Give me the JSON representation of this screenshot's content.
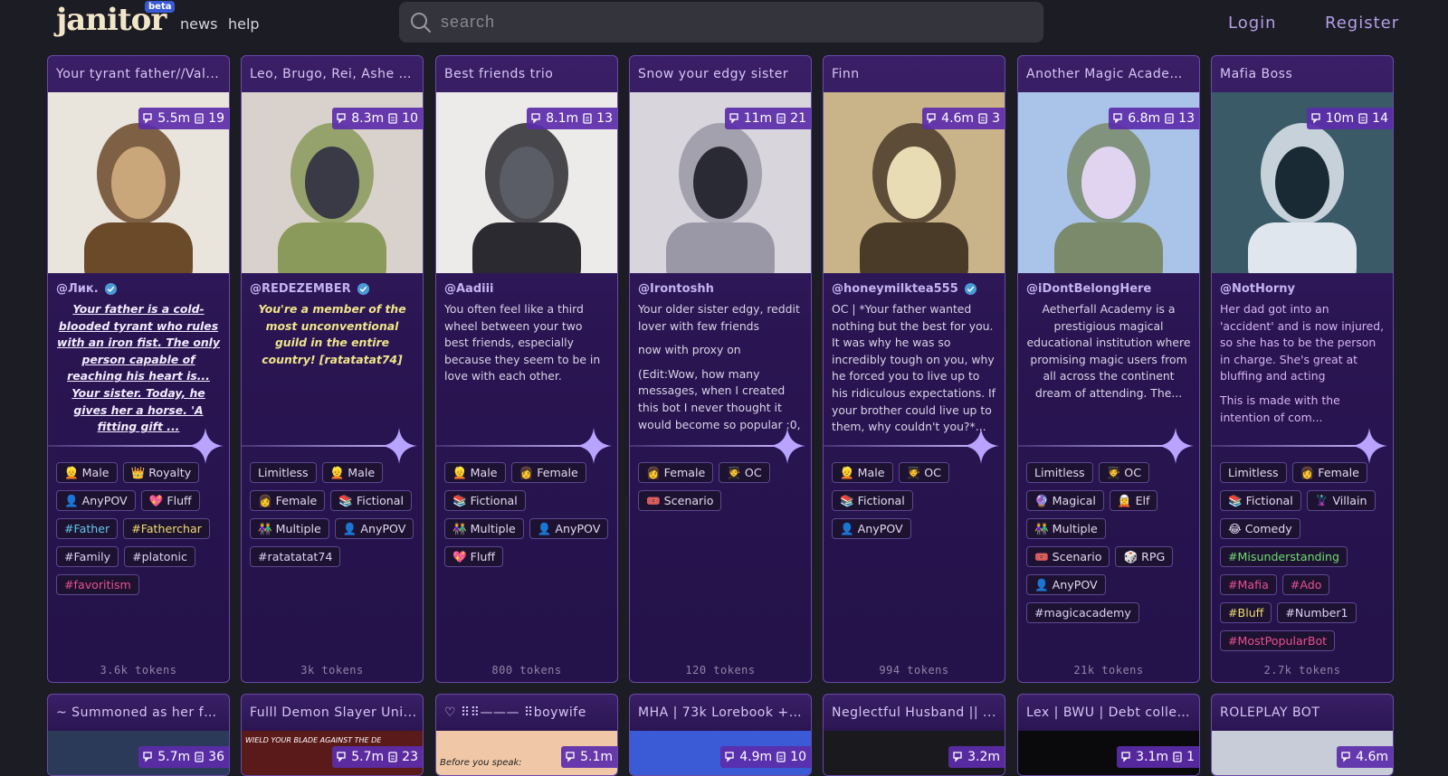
{
  "header": {
    "logo": "janitor",
    "beta": "beta",
    "nav": [
      "news",
      "help"
    ],
    "search_placeholder": "search",
    "login": "Login",
    "register": "Register"
  },
  "row1": [
    {
      "title": "Your tyrant father//Val...",
      "chats": "5.5m",
      "messages": "19",
      "creator": "@Лик.",
      "verified": true,
      "desc": [
        "Your father is a cold-blooded tyrant who rules with an iron fist. The only person capable of reaching his heart is... Your sister. Today, he gives her a horse. 'A fitting gift ..."
      ],
      "tags": [
        {
          "t": "👱 Male",
          "c": ""
        },
        {
          "t": "👑 Royalty",
          "c": ""
        },
        {
          "t": "👤 AnyPOV",
          "c": ""
        },
        {
          "t": "💖 Fluff",
          "c": ""
        },
        {
          "t": "#Father",
          "c": "cyan"
        },
        {
          "t": "#Fatherchar",
          "c": "yellow"
        },
        {
          "t": "#Family",
          "c": "lav"
        },
        {
          "t": "#platonic",
          "c": "lav"
        },
        {
          "t": "#favoritism",
          "c": "pink"
        }
      ],
      "tokens": "3.6k tokens"
    },
    {
      "title": "Leo, Brugo, Rei, Ashe a...",
      "chats": "8.3m",
      "messages": "10",
      "creator": "@REDEZEMBER",
      "verified": true,
      "desc": [
        "You're a member of the most unconventional guild in the entire country! [ratatatat74]"
      ],
      "tags": [
        {
          "t": "Limitless",
          "c": ""
        },
        {
          "t": "👱 Male",
          "c": ""
        },
        {
          "t": "👩 Female",
          "c": ""
        },
        {
          "t": "📚 Fictional",
          "c": ""
        },
        {
          "t": "👫 Multiple",
          "c": ""
        },
        {
          "t": "👤 AnyPOV",
          "c": ""
        },
        {
          "t": "#ratatatat74",
          "c": "lav"
        }
      ],
      "tokens": "3k tokens"
    },
    {
      "title": "Best friends trio",
      "chats": "8.1m",
      "messages": "13",
      "creator": "@Aadiii",
      "verified": false,
      "desc": [
        "You often feel like a third wheel between your two best friends, especially because they seem to be in love with each other."
      ],
      "tags": [
        {
          "t": "👱 Male",
          "c": ""
        },
        {
          "t": "👩 Female",
          "c": ""
        },
        {
          "t": "📚 Fictional",
          "c": ""
        },
        {
          "t": "👫 Multiple",
          "c": ""
        },
        {
          "t": "👤 AnyPOV",
          "c": ""
        },
        {
          "t": "💖 Fluff",
          "c": ""
        }
      ],
      "tokens": "800 tokens"
    },
    {
      "title": "Snow your edgy sister",
      "chats": "11m",
      "messages": "21",
      "creator": "@Irontoshh",
      "verified": false,
      "desc": [
        "Your older sister edgy, reddit lover with few friends",
        "now with proxy on",
        "(Edit:Wow, how many messages, when I created this bot I never thought it would become so popular :0, Thank you very much to everyone, a..."
      ],
      "tags": [
        {
          "t": "👩 Female",
          "c": ""
        },
        {
          "t": "🧑‍🎓 OC",
          "c": ""
        },
        {
          "t": "🎟️ Scenario",
          "c": ""
        }
      ],
      "tokens": "120 tokens"
    },
    {
      "title": "Finn",
      "chats": "4.6m",
      "messages": "3",
      "creator": "@honeymilktea555",
      "verified": true,
      "desc": [
        "OC | *Your father wanted nothing but the best for you. It was why he was so incredibly tough on you, why he forced you to live up to his ridiculous expectations. If your brother could live up to them, why couldn't you?*..."
      ],
      "tags": [
        {
          "t": "👱 Male",
          "c": ""
        },
        {
          "t": "🧑‍🎓 OC",
          "c": ""
        },
        {
          "t": "📚 Fictional",
          "c": ""
        },
        {
          "t": "👤 AnyPOV",
          "c": ""
        }
      ],
      "tokens": "994 tokens"
    },
    {
      "title": "Another Magic Academ...",
      "chats": "6.8m",
      "messages": "13",
      "creator": "@iDontBelongHere",
      "verified": false,
      "desc": [
        "Aetherfall Academy is a prestigious magical educational institution where promising magic users from all across the continent dream of attending. The..."
      ],
      "tags": [
        {
          "t": "Limitless",
          "c": ""
        },
        {
          "t": "🧑‍🎓 OC",
          "c": ""
        },
        {
          "t": "🔮 Magical",
          "c": ""
        },
        {
          "t": "🧝 Elf",
          "c": ""
        },
        {
          "t": "👫 Multiple",
          "c": ""
        },
        {
          "t": "🎟️ Scenario",
          "c": ""
        },
        {
          "t": "🎲 RPG",
          "c": ""
        },
        {
          "t": "👤 AnyPOV",
          "c": ""
        },
        {
          "t": "#magicacademy",
          "c": "lav"
        }
      ],
      "tokens": "21k tokens"
    },
    {
      "title": "Mafia Boss",
      "chats": "10m",
      "messages": "14",
      "creator": "@NotHorny",
      "verified": false,
      "desc": [
        "Her dad got into an 'accident' and is now injured, so she has to be the person in charge. She's great at bluffing and acting",
        "This is made with the intention of com..."
      ],
      "tags": [
        {
          "t": "Limitless",
          "c": ""
        },
        {
          "t": "👩 Female",
          "c": ""
        },
        {
          "t": "📚 Fictional",
          "c": ""
        },
        {
          "t": "🦹 Villain",
          "c": ""
        },
        {
          "t": "😂 Comedy",
          "c": ""
        },
        {
          "t": "#Misunderstanding",
          "c": "green"
        },
        {
          "t": "#Mafia",
          "c": "pink"
        },
        {
          "t": "#Ado",
          "c": "pink"
        },
        {
          "t": "#Bluff",
          "c": "yellow"
        },
        {
          "t": "#Number1",
          "c": "lav"
        },
        {
          "t": "#MostPopularBot",
          "c": "pink"
        }
      ],
      "tokens": "2.7k tokens"
    }
  ],
  "row2": [
    {
      "title": "~ Summoned as her fa...",
      "chats": "5.7m",
      "messages": "36"
    },
    {
      "title": "Fulll Demon Slayer Uni...",
      "chats": "5.7m",
      "messages": "23",
      "banner": "WIELD YOUR BLADE AGAINST THE DEMONS DRAWING NEAR"
    },
    {
      "title": "♡ ⠿⠿——— ⠿boywife",
      "chats": "5.1m",
      "messages": "",
      "banner": "Before you speak:"
    },
    {
      "title": "MHA | 73k Lorebook + M...",
      "chats": "4.9m",
      "messages": "10"
    },
    {
      "title": "Neglectful Husband || ...",
      "chats": "3.2m",
      "messages": ""
    },
    {
      "title": "Lex | BWU | Debt collec...",
      "chats": "3.1m",
      "messages": "1"
    },
    {
      "title": "ROLEPLAY BOT",
      "chats": "4.6m",
      "messages": ""
    }
  ],
  "colors": {
    "accent": "#6a4aa8",
    "card_top": "#3a1f66",
    "stats_bg": "#5c2caa",
    "auth_link": "#b49fe6"
  }
}
